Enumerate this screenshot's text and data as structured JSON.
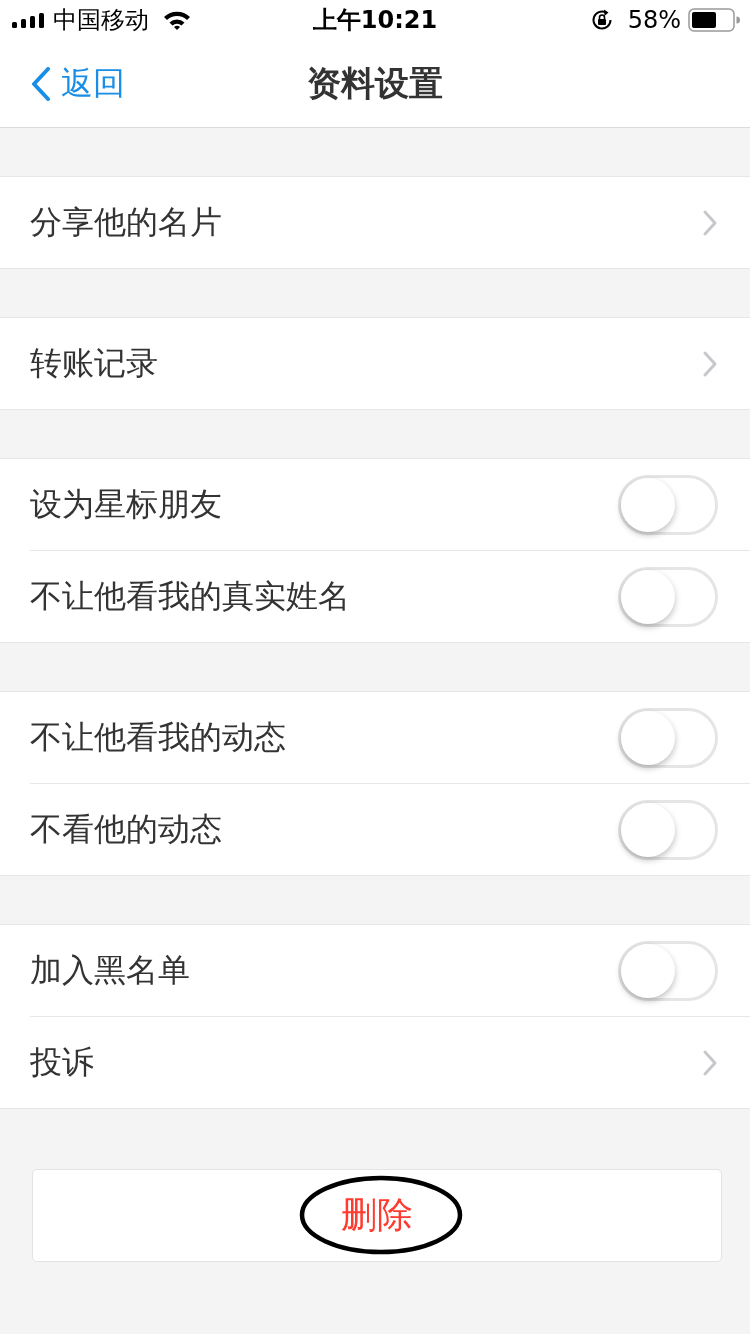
{
  "status_bar": {
    "carrier": "中国移动",
    "time": "上午10:21",
    "battery_percent": "58%"
  },
  "nav": {
    "back": "返回",
    "title": "资料设置"
  },
  "groups": [
    {
      "items": [
        {
          "kind": "link",
          "label": "分享他的名片"
        }
      ]
    },
    {
      "items": [
        {
          "kind": "link",
          "label": "转账记录"
        }
      ]
    },
    {
      "items": [
        {
          "kind": "toggle",
          "label": "设为星标朋友",
          "on": false
        },
        {
          "kind": "toggle",
          "label": "不让他看我的真实姓名",
          "on": false
        }
      ]
    },
    {
      "items": [
        {
          "kind": "toggle",
          "label": "不让他看我的动态",
          "on": false
        },
        {
          "kind": "toggle",
          "label": "不看他的动态",
          "on": false
        }
      ]
    },
    {
      "items": [
        {
          "kind": "toggle",
          "label": "加入黑名单",
          "on": false
        },
        {
          "kind": "link",
          "label": "投诉"
        }
      ]
    }
  ],
  "delete_button": {
    "label": "删除",
    "circled": true
  }
}
